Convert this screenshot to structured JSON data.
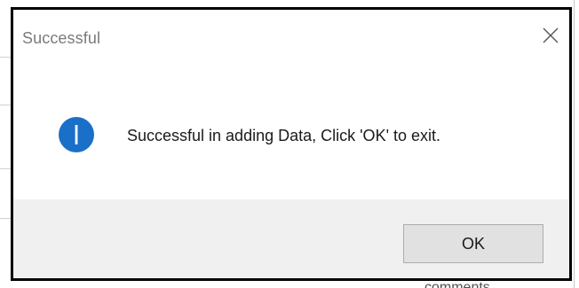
{
  "dialog": {
    "title": "Successful",
    "message": "Successful in adding Data, Click 'OK' to exit.",
    "ok_label": "OK",
    "icon": "info-icon",
    "accent_color": "#1a6fc9"
  },
  "background": {
    "partial_text": "comments"
  }
}
